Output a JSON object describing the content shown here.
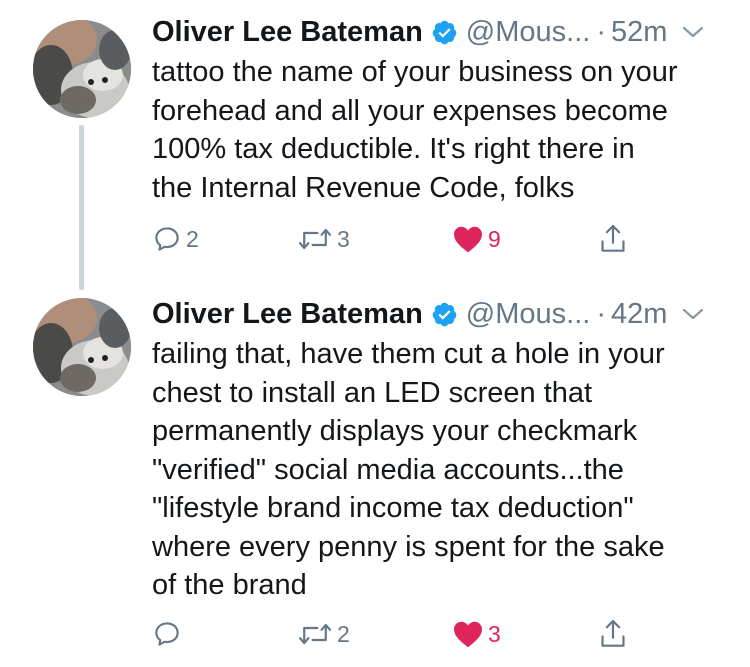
{
  "tweets": [
    {
      "author_name": "Oliver Lee Bateman",
      "handle": "@Mous...",
      "separator": "·",
      "time": "52m",
      "text_lines": [
        "tattoo the name of your business on your",
        "forehead and all your expenses become",
        "100% tax deductible. It's right there in",
        "the Internal Revenue Code, folks"
      ],
      "reply_count": "2",
      "retweet_count": "3",
      "like_count": "9",
      "liked": true
    },
    {
      "author_name": "Oliver Lee Bateman",
      "handle": "@Mous...",
      "separator": "·",
      "time": "42m",
      "text_lines": [
        "failing that, have them cut a hole in your",
        "chest to install an LED screen that",
        "permanently displays your checkmark",
        "\"verified\" social media accounts...the",
        "\"lifestyle brand income tax deduction\"",
        "where every penny is spent for the sake",
        "of the brand"
      ],
      "reply_count": "",
      "retweet_count": "2",
      "like_count": "3",
      "liked": true
    }
  ],
  "colors": {
    "text": "#14171a",
    "secondary": "#657786",
    "verified_blue": "#1da1f2",
    "like_red": "#e0245e",
    "thread_line": "#ccd6dd"
  },
  "icons": {
    "reply": "reply-icon",
    "retweet": "retweet-icon",
    "like": "heart-icon",
    "share": "share-icon",
    "verified": "verified-badge-icon",
    "caret": "chevron-down-icon"
  }
}
